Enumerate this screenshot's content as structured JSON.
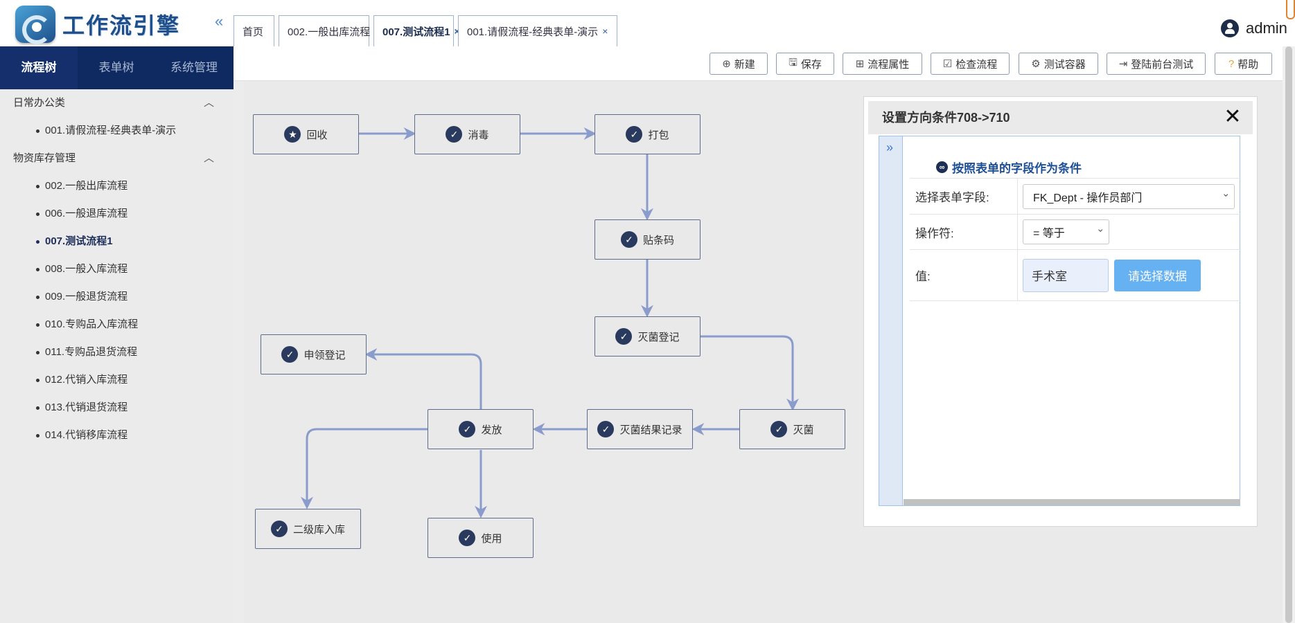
{
  "app": {
    "title": "工作流引擎",
    "collapse_glyph": "«"
  },
  "tabs": [
    {
      "label": "首页",
      "closable": false,
      "active": false
    },
    {
      "label": "002.一般出库流程",
      "closable": true,
      "active": false
    },
    {
      "label": "007.测试流程1",
      "closable": true,
      "active": true
    },
    {
      "label": "001.请假流程-经典表单-演示",
      "closable": true,
      "active": false
    }
  ],
  "tab_close_glyph": "×",
  "user": {
    "name": "admin"
  },
  "side_tabs": [
    {
      "label": "流程树",
      "active": true
    },
    {
      "label": "表单树",
      "active": false
    },
    {
      "label": "系统管理",
      "active": false
    }
  ],
  "tree": {
    "groups": [
      {
        "label": "日常办公类",
        "items": [
          {
            "label": "001.请假流程-经典表单-演示"
          }
        ]
      },
      {
        "label": "物资库存管理",
        "items": [
          {
            "label": "002.一般出库流程"
          },
          {
            "label": "006.一般退库流程"
          },
          {
            "label": "007.测试流程1",
            "active": true
          },
          {
            "label": "008.一般入库流程"
          },
          {
            "label": "009.一般退货流程"
          },
          {
            "label": "010.专购品入库流程"
          },
          {
            "label": "011.专购品退货流程"
          },
          {
            "label": "012.代销入库流程"
          },
          {
            "label": "013.代销退货流程"
          },
          {
            "label": "014.代销移库流程"
          }
        ]
      }
    ]
  },
  "toolbar": {
    "buttons": [
      {
        "label": "新建",
        "icon": "plus-circle-icon",
        "glyph": "⊕"
      },
      {
        "label": "保存",
        "icon": "save-icon",
        "glyph": "🖫"
      },
      {
        "label": "流程属性",
        "icon": "properties-icon",
        "glyph": "⊞"
      },
      {
        "label": "检查流程",
        "icon": "check-icon",
        "glyph": "☑"
      },
      {
        "label": "测试容器",
        "icon": "container-icon",
        "glyph": "⚙"
      },
      {
        "label": "登陆前台测试",
        "icon": "login-icon",
        "glyph": "⇥"
      },
      {
        "label": "帮助",
        "icon": "help-icon",
        "glyph": "?"
      }
    ]
  },
  "flow": {
    "nodes": [
      {
        "id": "n1",
        "label": "回收",
        "icon": "star-icon",
        "glyph": "★"
      },
      {
        "id": "n2",
        "label": "消毒",
        "icon": "check-circle-icon",
        "glyph": "✓"
      },
      {
        "id": "n3",
        "label": "打包",
        "icon": "check-circle-icon",
        "glyph": "✓"
      },
      {
        "id": "n4",
        "label": "贴条码",
        "icon": "check-circle-icon",
        "glyph": "✓"
      },
      {
        "id": "n5",
        "label": "灭菌登记",
        "icon": "check-circle-icon",
        "glyph": "✓"
      },
      {
        "id": "n6",
        "label": "申领登记",
        "icon": "check-circle-icon",
        "glyph": "✓"
      },
      {
        "id": "n7",
        "label": "发放",
        "icon": "check-circle-icon",
        "glyph": "✓"
      },
      {
        "id": "n8",
        "label": "灭菌结果记录",
        "icon": "check-circle-icon",
        "glyph": "✓"
      },
      {
        "id": "n9",
        "label": "灭菌",
        "icon": "check-circle-icon",
        "glyph": "✓"
      },
      {
        "id": "n10",
        "label": "二级库入库",
        "icon": "check-circle-icon",
        "glyph": "✓"
      },
      {
        "id": "n11",
        "label": "使用",
        "icon": "check-circle-icon",
        "glyph": "✓"
      }
    ],
    "line_color": "#8a9ccc"
  },
  "panel": {
    "title": "设置方向条件708->710",
    "close_glyph": "✕",
    "expand_glyph": "»",
    "condition_title": "按照表单的字段作为条件",
    "field_label": "选择表单字段:",
    "field_value": "FK_Dept - 操作员部门",
    "operator_label": "操作符:",
    "operator_value": "= 等于",
    "value_label": "值:",
    "value_input": "手术室",
    "pick_button": "请选择数据"
  }
}
